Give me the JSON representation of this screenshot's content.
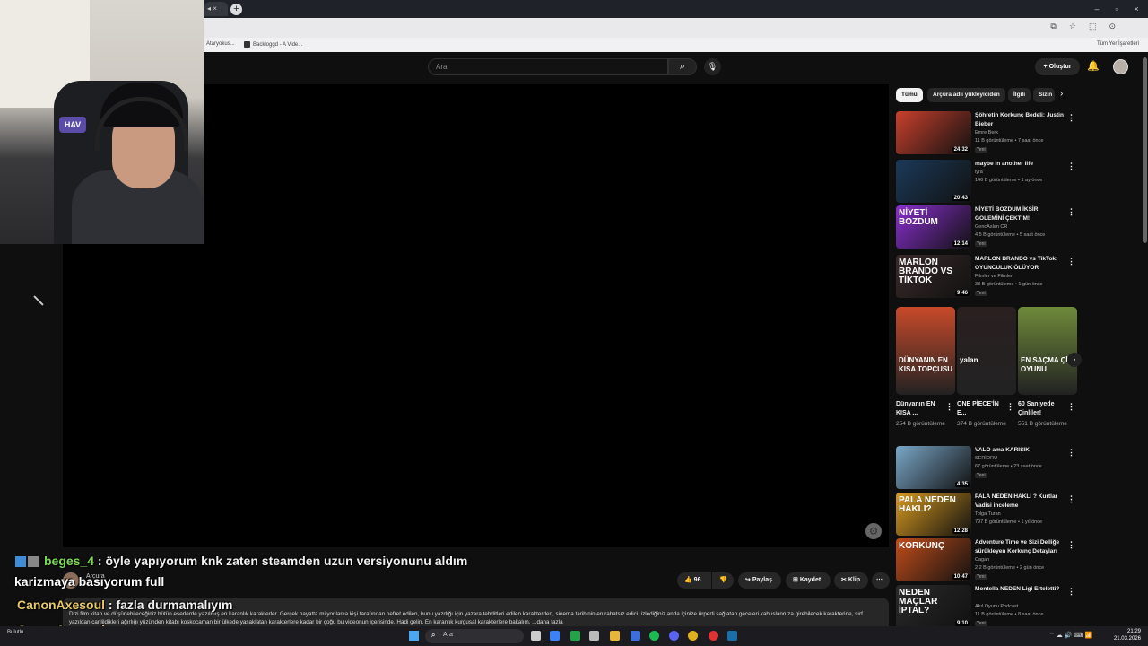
{
  "browser": {
    "tab_icons": "◂ ×",
    "new_tab": "+",
    "min": "–",
    "max": "▫",
    "close": "×",
    "url_icons": [
      "⧉",
      "☆",
      "⬚",
      "⊙"
    ],
    "bookmarks": [
      {
        "label": "Ataryokus..."
      },
      {
        "label": "Backloggd - A Vide..."
      }
    ],
    "all_bookmarks": "Tüm Yer İşaretleri"
  },
  "header": {
    "search_placeholder": "Ara",
    "search_icon": "⌕",
    "mic_icon": "🎙",
    "create_label": "+ Oluştur",
    "bell_icon": "🔔"
  },
  "chips": [
    {
      "label": "Tümü",
      "active": true
    },
    {
      "label": "Arçura adlı yükleyiciden"
    },
    {
      "label": "İlgili"
    },
    {
      "label": "Sizin"
    }
  ],
  "chip_next": "›",
  "videos": [
    {
      "title": "Şöhretin Korkunç Bedeli: Justin Bieber",
      "channel": "Emre Berk",
      "meta": "11 B görüntüleme • 7 saat önce",
      "badge": "Yeni",
      "duration": "24:32",
      "thumb_color": "#c9402d"
    },
    {
      "title": "maybe in another life",
      "channel": "lyra",
      "meta": "146 B görüntüleme • 1 ay önce",
      "badge": "",
      "duration": "20:43",
      "thumb_color": "#1b3a5a"
    },
    {
      "title": "NİYETİ BOZDUM İKSİR GOLEMİNİ ÇEKTİM!",
      "channel": "GencAslan CR",
      "meta": "4,5 B görüntüleme • 5 saat önce",
      "badge": "Yeni",
      "duration": "12:14",
      "thumb_color": "#8a2fd0",
      "thumb_text": "NİYETİ BOZDUM"
    },
    {
      "title": "MARLON BRANDO vs TikTok; OYUNCULUK ÖLÜYOR",
      "channel": "Filmler ve Filmler",
      "meta": "38 B görüntüleme • 1 gün önce",
      "badge": "Yeni",
      "duration": "9:46",
      "thumb_color": "#3a2a2a",
      "thumb_text": "MARLON BRANDO VS TİKTOK"
    },
    {
      "title": "VALO ama KARIŞIK",
      "channel": "SERİORU",
      "meta": "67 görüntüleme • 23 saat önce",
      "badge": "Yeni",
      "duration": "4:35",
      "thumb_color": "#7aa7c8"
    },
    {
      "title": "PALA NEDEN HAKLI ? Kurtlar Vadisi inceleme",
      "channel": "Tolga Turan",
      "meta": "797 B görüntüleme • 1 yıl önce",
      "badge": "",
      "duration": "12:28",
      "thumb_color": "#d89a20",
      "thumb_text": "PALA NEDEN HAKLI?"
    },
    {
      "title": "Adventure Time ve Sizi Delliğe sürükleyen Korkunç Detayları",
      "channel": "Cagan",
      "meta": "2,2 B görüntüleme • 2 gün önce",
      "badge": "Yeni",
      "duration": "10:47",
      "thumb_color": "#c24d1a",
      "thumb_text": "KORKUNÇ"
    },
    {
      "title": "Montella NEDEN Ligi Erteletti?",
      "channel": "Akıl Oyunu Podcast",
      "meta": "11 B görüntüleme • 8 saat önce",
      "badge": "Yeni",
      "duration": "9:10",
      "thumb_color": "#2a2a2a",
      "thumb_text": "NEDEN MAÇLAR İPTAL?"
    }
  ],
  "shorts": [
    {
      "title": "Dünyanın EN KISA ...",
      "views": "254 B görüntüleme",
      "color": "#c94a2a",
      "thumb_text": "DÜNYANIN EN KISA TOPÇUSU"
    },
    {
      "title": "ONE PİECE'İN E...",
      "views": "374 B görüntüleme",
      "color": "#2a2020",
      "thumb_text": "yalan"
    },
    {
      "title": "60 Saniyede Çinliler!",
      "views": "551 B görüntüleme",
      "color": "#6f8a3a",
      "thumb_text": "EN SAÇMA ÇİN OYUNU"
    }
  ],
  "shorts_next": "›",
  "actions": {
    "likes": "96",
    "like_icon": "👍",
    "dislike_icon": "👎",
    "share": "Paylaş",
    "save": "Kaydet",
    "clip": "Klip",
    "more": "⋯"
  },
  "description": "Dizi film kitap ve düşünebileceğiniz bütün eserlerde yazılmış en karanlık karakterler. Gerçek hayatta milyonlarca kişi tarafından nefret edilen, bunu yazdığı için yazara tehditleri edilen karakterden, sinema tarihinin en rahatsız edici, izlediğiniz anda içinize ürperti sağlatan geceleri kabuslannıza girebilecek karakterine, sırf yazıldan canlildikleri ağırlığı yüzünden kitabı koskocaman bir ülkede yasaklatan karakterlere kadar bir çoğu bu videonun içerisinde. Hadi gelin, En karanlık kurgusal karakterlere bakalım. ...daha fazla",
  "chat": [
    {
      "user": "beges_4",
      "text": "öyle yapıyorum knk zaten steamden uzun versiyonunu aldım"
    },
    {
      "user": "",
      "text": "karizmaya basıyorum full"
    },
    {
      "user": "CanonAxesoul",
      "text": "fazla durmamalıyım"
    },
    {
      "user": "CanonAxesoul",
      "text": "sanırım"
    }
  ],
  "chat_sep": " : ",
  "channel_name": "Arçura",
  "webcam_logo": "HAV",
  "player_gear": "⚙",
  "taskbar": {
    "search": "Ara",
    "search_icon": "⌕",
    "weather": "Bulutlu",
    "time": "21:29",
    "date": "21.03.2026",
    "tray": "⌃ ☁ 🔊 ⌨ 📶"
  }
}
